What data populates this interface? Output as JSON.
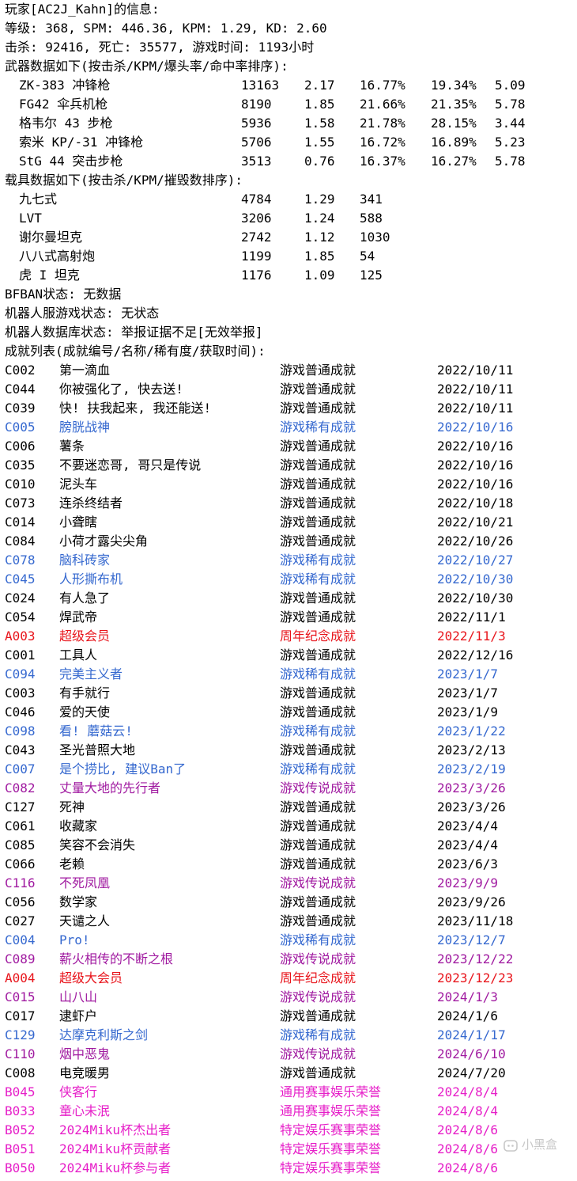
{
  "colors": {
    "normal": "#000000",
    "rare": "#3568cf",
    "legend": "#a01aa0",
    "anniversary": "#e8141b",
    "event": "#e61ec8"
  },
  "header": {
    "player": "玩家[AC2J_Kahn]的信息:",
    "stats1": "等级: 368, SPM: 446.36, KPM: 1.29, KD: 2.60",
    "stats2": "击杀: 92416, 死亡: 35577, 游戏时间: 1193小时"
  },
  "weapons": {
    "title": "武器数据如下(按击杀/KPM/爆头率/命中率排序):",
    "rows": [
      {
        "name": "ZK-383 冲锋枪",
        "kills": "13163",
        "kpm": "2.17",
        "hs": "16.77%",
        "acc": "19.34%",
        "extra": "5.09"
      },
      {
        "name": "FG42 伞兵机枪",
        "kills": "8190",
        "kpm": "1.85",
        "hs": "21.66%",
        "acc": "21.35%",
        "extra": "5.78"
      },
      {
        "name": "格韦尔 43 步枪",
        "kills": "5936",
        "kpm": "1.58",
        "hs": "21.78%",
        "acc": "28.15%",
        "extra": "3.44"
      },
      {
        "name": "索米 KP/-31 冲锋枪",
        "kills": "5706",
        "kpm": "1.55",
        "hs": "16.72%",
        "acc": "16.89%",
        "extra": "5.23"
      },
      {
        "name": "StG 44 突击步枪",
        "kills": "3513",
        "kpm": "0.76",
        "hs": "16.37%",
        "acc": "16.27%",
        "extra": "5.78"
      }
    ]
  },
  "vehicles": {
    "title": "载具数据如下(按击杀/KPM/摧毁数排序):",
    "rows": [
      {
        "name": "九七式",
        "kills": "4784",
        "kpm": "1.29",
        "destroyed": "341"
      },
      {
        "name": "LVT",
        "kills": "3206",
        "kpm": "1.24",
        "destroyed": "588"
      },
      {
        "name": "谢尔曼坦克",
        "kills": "2742",
        "kpm": "1.12",
        "destroyed": "1030"
      },
      {
        "name": "八八式高射炮",
        "kills": "1199",
        "kpm": "1.85",
        "destroyed": "54"
      },
      {
        "name": "虎 I 坦克",
        "kills": "1176",
        "kpm": "1.09",
        "destroyed": "125"
      }
    ]
  },
  "status": {
    "bfban": "BFBAN状态: 无数据",
    "robot_game": "机器人服游戏状态: 无状态",
    "robot_db": "机器人数据库状态: 举报证据不足[无效举报]"
  },
  "achievements": {
    "title": "成就列表(成就编号/名称/稀有度/获取时间):",
    "rows": [
      {
        "code": "C002",
        "name": "第一滴血",
        "rarity": "游戏普通成就",
        "date": "2022/10/11",
        "tier": "normal"
      },
      {
        "code": "C044",
        "name": "你被强化了, 快去送!",
        "rarity": "游戏普通成就",
        "date": "2022/10/11",
        "tier": "normal"
      },
      {
        "code": "C039",
        "name": "快! 扶我起来, 我还能送!",
        "rarity": "游戏普通成就",
        "date": "2022/10/11",
        "tier": "normal"
      },
      {
        "code": "C005",
        "name": "膀胱战神",
        "rarity": "游戏稀有成就",
        "date": "2022/10/16",
        "tier": "rare"
      },
      {
        "code": "C006",
        "name": "薯条",
        "rarity": "游戏普通成就",
        "date": "2022/10/16",
        "tier": "normal"
      },
      {
        "code": "C035",
        "name": "不要迷恋哥, 哥只是传说",
        "rarity": "游戏普通成就",
        "date": "2022/10/16",
        "tier": "normal"
      },
      {
        "code": "C010",
        "name": "泥头车",
        "rarity": "游戏普通成就",
        "date": "2022/10/16",
        "tier": "normal"
      },
      {
        "code": "C073",
        "name": "连杀终结者",
        "rarity": "游戏普通成就",
        "date": "2022/10/18",
        "tier": "normal"
      },
      {
        "code": "C014",
        "name": "小聋瞎",
        "rarity": "游戏普通成就",
        "date": "2022/10/21",
        "tier": "normal"
      },
      {
        "code": "C084",
        "name": "小荷才露尖尖角",
        "rarity": "游戏普通成就",
        "date": "2022/10/26",
        "tier": "normal"
      },
      {
        "code": "C078",
        "name": "脑科砖家",
        "rarity": "游戏稀有成就",
        "date": "2022/10/27",
        "tier": "rare"
      },
      {
        "code": "C045",
        "name": "人形撕布机",
        "rarity": "游戏稀有成就",
        "date": "2022/10/30",
        "tier": "rare"
      },
      {
        "code": "C024",
        "name": "有人急了",
        "rarity": "游戏普通成就",
        "date": "2022/10/30",
        "tier": "normal"
      },
      {
        "code": "C054",
        "name": "焊武帝",
        "rarity": "游戏普通成就",
        "date": "2022/11/1",
        "tier": "normal"
      },
      {
        "code": "A003",
        "name": "超级会员",
        "rarity": "周年纪念成就",
        "date": "2022/11/3",
        "tier": "anniversary"
      },
      {
        "code": "C001",
        "name": "工具人",
        "rarity": "游戏普通成就",
        "date": "2022/12/16",
        "tier": "normal"
      },
      {
        "code": "C094",
        "name": "完美主义者",
        "rarity": "游戏稀有成就",
        "date": "2023/1/7",
        "tier": "rare"
      },
      {
        "code": "C003",
        "name": "有手就行",
        "rarity": "游戏普通成就",
        "date": "2023/1/7",
        "tier": "normal"
      },
      {
        "code": "C046",
        "name": "爱的天使",
        "rarity": "游戏普通成就",
        "date": "2023/1/9",
        "tier": "normal"
      },
      {
        "code": "C098",
        "name": "看! 蘑菇云!",
        "rarity": "游戏稀有成就",
        "date": "2023/1/22",
        "tier": "rare"
      },
      {
        "code": "C043",
        "name": "圣光普照大地",
        "rarity": "游戏普通成就",
        "date": "2023/2/13",
        "tier": "normal"
      },
      {
        "code": "C007",
        "name": "是个捞比, 建议Ban了",
        "rarity": "游戏稀有成就",
        "date": "2023/2/19",
        "tier": "rare"
      },
      {
        "code": "C082",
        "name": "丈量大地的先行者",
        "rarity": "游戏传说成就",
        "date": "2023/3/26",
        "tier": "legend"
      },
      {
        "code": "C127",
        "name": "死神",
        "rarity": "游戏普通成就",
        "date": "2023/3/26",
        "tier": "normal"
      },
      {
        "code": "C061",
        "name": "收藏家",
        "rarity": "游戏普通成就",
        "date": "2023/4/4",
        "tier": "normal"
      },
      {
        "code": "C085",
        "name": "笑容不会消失",
        "rarity": "游戏普通成就",
        "date": "2023/4/4",
        "tier": "normal"
      },
      {
        "code": "C066",
        "name": "老赖",
        "rarity": "游戏普通成就",
        "date": "2023/6/3",
        "tier": "normal"
      },
      {
        "code": "C116",
        "name": "不死凤凰",
        "rarity": "游戏传说成就",
        "date": "2023/9/9",
        "tier": "legend"
      },
      {
        "code": "C056",
        "name": "数学家",
        "rarity": "游戏普通成就",
        "date": "2023/9/26",
        "tier": "normal"
      },
      {
        "code": "C027",
        "name": "天谴之人",
        "rarity": "游戏普通成就",
        "date": "2023/11/18",
        "tier": "normal"
      },
      {
        "code": "C004",
        "name": "Pro!",
        "rarity": "游戏稀有成就",
        "date": "2023/12/7",
        "tier": "rare"
      },
      {
        "code": "C089",
        "name": "薪火相传的不断之根",
        "rarity": "游戏传说成就",
        "date": "2023/12/22",
        "tier": "legend"
      },
      {
        "code": "A004",
        "name": "超级大会员",
        "rarity": "周年纪念成就",
        "date": "2023/12/23",
        "tier": "anniversary"
      },
      {
        "code": "C015",
        "name": "山八山",
        "rarity": "游戏传说成就",
        "date": "2024/1/3",
        "tier": "legend"
      },
      {
        "code": "C017",
        "name": "逮虾户",
        "rarity": "游戏普通成就",
        "date": "2024/1/6",
        "tier": "normal"
      },
      {
        "code": "C129",
        "name": "达摩克利斯之剑",
        "rarity": "游戏稀有成就",
        "date": "2024/1/17",
        "tier": "rare"
      },
      {
        "code": "C110",
        "name": "烟中恶鬼",
        "rarity": "游戏传说成就",
        "date": "2024/6/10",
        "tier": "legend"
      },
      {
        "code": "C008",
        "name": "电竞暖男",
        "rarity": "游戏普通成就",
        "date": "2024/7/20",
        "tier": "normal"
      },
      {
        "code": "B045",
        "name": "侠客行",
        "rarity": "通用赛事娱乐荣誉",
        "date": "2024/8/4",
        "tier": "event"
      },
      {
        "code": "B033",
        "name": "童心未泯",
        "rarity": "通用赛事娱乐荣誉",
        "date": "2024/8/4",
        "tier": "event"
      },
      {
        "code": "B052",
        "name": "2024Miku杯杰出者",
        "rarity": "特定娱乐赛事荣誉",
        "date": "2024/8/6",
        "tier": "event"
      },
      {
        "code": "B051",
        "name": "2024Miku杯贡献者",
        "rarity": "特定娱乐赛事荣誉",
        "date": "2024/8/6",
        "tier": "event"
      },
      {
        "code": "B050",
        "name": "2024Miku杯参与者",
        "rarity": "特定娱乐赛事荣誉",
        "date": "2024/8/6",
        "tier": "event"
      }
    ]
  },
  "watermark": {
    "text": "小黑盒",
    "icon": "xiaoheihe-logo-icon"
  }
}
